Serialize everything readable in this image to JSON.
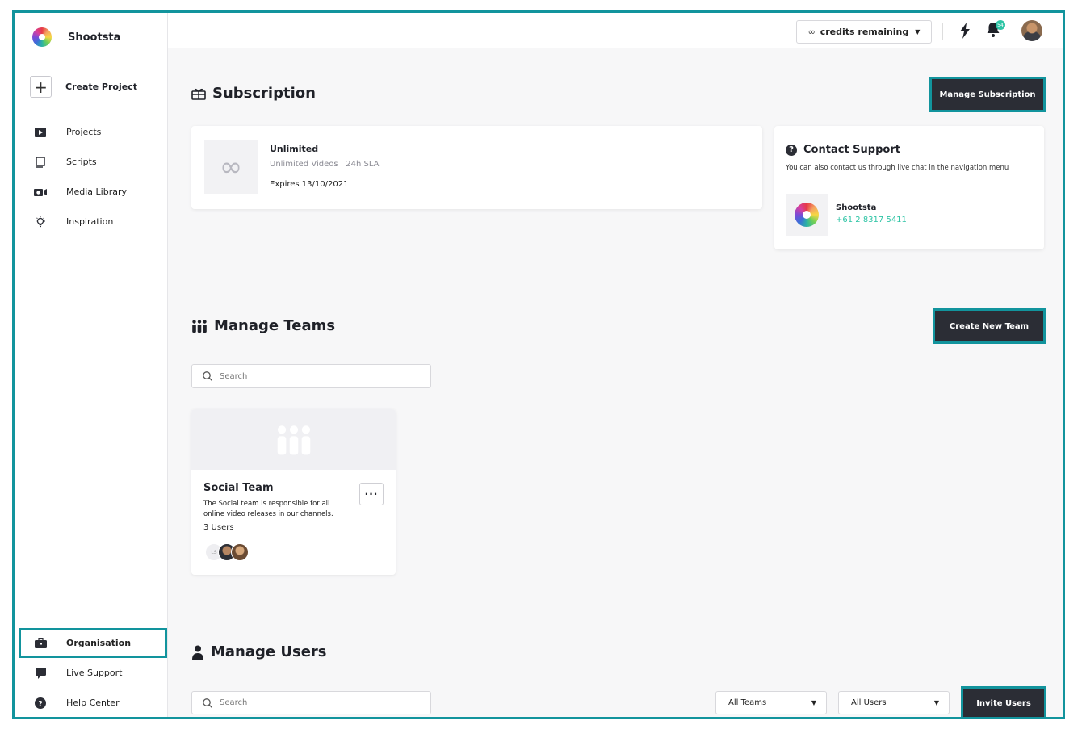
{
  "app": {
    "name": "Shootsta"
  },
  "sidebar": {
    "create_project": "Create Project",
    "items": [
      {
        "label": "Projects",
        "icon": "film-icon"
      },
      {
        "label": "Scripts",
        "icon": "script-icon"
      },
      {
        "label": "Media Library",
        "icon": "camera-icon"
      },
      {
        "label": "Inspiration",
        "icon": "lightbulb-icon"
      }
    ],
    "bottom_items": [
      {
        "label": "Organisation",
        "icon": "briefcase-icon",
        "active": true
      },
      {
        "label": "Live Support",
        "icon": "chat-icon"
      },
      {
        "label": "Help Center",
        "icon": "help-icon"
      }
    ]
  },
  "topbar": {
    "credits_label": "credits remaining",
    "credits_symbol": "∞",
    "notification_count": "54"
  },
  "subscription": {
    "title": "Subscription",
    "manage_button": "Manage Subscription",
    "plan": "Unlimited",
    "description": "Unlimited Videos | 24h SLA",
    "expires": "Expires 13/10/2021",
    "thumb_symbol": "∞"
  },
  "support": {
    "title": "Contact Support",
    "text": "You can also contact us through live chat in the navigation menu",
    "contact_name": "Shootsta",
    "contact_phone": "+61 2 8317 5411"
  },
  "teams": {
    "title": "Manage Teams",
    "create_button": "Create New Team",
    "search_placeholder": "Search",
    "cards": [
      {
        "name": "Social Team",
        "description": "The Social team is responsible for all online video releases in our channels.",
        "users": "3 Users",
        "avatar_initials": "LS"
      }
    ]
  },
  "users": {
    "title": "Manage Users",
    "search_placeholder": "Search",
    "teams_filter": "All Teams",
    "users_filter": "All Users",
    "invite_button": "Invite Users"
  },
  "colors": {
    "accent": "#12949d",
    "dark_button": "#2b2d35",
    "phone": "#2ec4a5"
  }
}
